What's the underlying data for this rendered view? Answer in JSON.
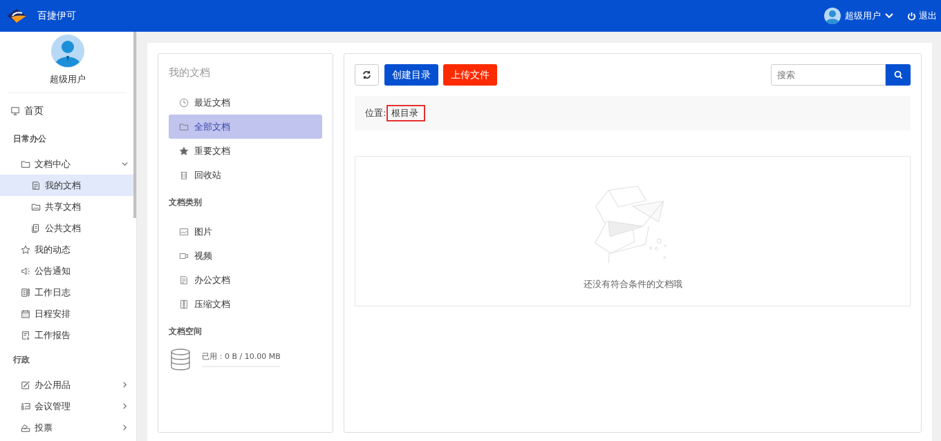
{
  "header": {
    "app_name": "百捷伊可",
    "user_name": "超级用户",
    "logout": "退出"
  },
  "sidebar": {
    "user_name": "超级用户",
    "items": [
      {
        "kind": "top",
        "label": "首页",
        "selected": false
      },
      {
        "kind": "section",
        "label": "日常办公"
      },
      {
        "kind": "group",
        "label": "文档中心",
        "expanded": true,
        "selected": false,
        "children": [
          {
            "label": "我的文档",
            "selected": true
          },
          {
            "label": "共享文档",
            "selected": false
          },
          {
            "label": "公共文档",
            "selected": false
          }
        ]
      },
      {
        "kind": "link",
        "label": "我的动态",
        "selected": false
      },
      {
        "kind": "link",
        "label": "公告通知",
        "selected": false
      },
      {
        "kind": "link",
        "label": "工作日志",
        "selected": false
      },
      {
        "kind": "link",
        "label": "日程安排",
        "selected": false
      },
      {
        "kind": "link",
        "label": "工作报告",
        "selected": false
      },
      {
        "kind": "section",
        "label": "行政"
      },
      {
        "kind": "group",
        "label": "办公用品",
        "expanded": false,
        "selected": false
      },
      {
        "kind": "group",
        "label": "会议管理",
        "expanded": false,
        "selected": false
      },
      {
        "kind": "group",
        "label": "投票",
        "expanded": false,
        "selected": false
      }
    ]
  },
  "doc_panel": {
    "title": "我的文档",
    "groups": [
      {
        "items": [
          {
            "label": "最近文档",
            "selected": false
          },
          {
            "label": "全部文档",
            "selected": true
          },
          {
            "label": "重要文档",
            "selected": false
          },
          {
            "label": "回收站",
            "selected": false
          }
        ]
      },
      {
        "heading": "文档类别",
        "items": [
          {
            "label": "图片",
            "selected": false
          },
          {
            "label": "视频",
            "selected": false
          },
          {
            "label": "办公文档",
            "selected": false
          },
          {
            "label": "压缩文档",
            "selected": false
          }
        ]
      }
    ],
    "storage": {
      "heading": "文档空间",
      "text": "已用：0 B / 10.00 MB",
      "level": 0
    }
  },
  "toolbar": {
    "create_button": "创建目录",
    "upload_button": "上传文件",
    "search": {
      "placeholder": "搜索"
    }
  },
  "location": {
    "label": "位置:",
    "path": "根目录"
  },
  "empty_state": {
    "message": "还没有符合条件的文档哦"
  }
}
